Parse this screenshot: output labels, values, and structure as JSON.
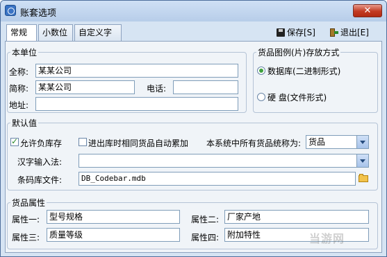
{
  "window": {
    "title": "账套选项",
    "close_label": "✕"
  },
  "tabs": [
    {
      "label": "常规"
    },
    {
      "label": "小数位"
    },
    {
      "label": "自定义字段"
    }
  ],
  "toolbar": {
    "save_label": "保存[S]",
    "exit_label": "退出[E]"
  },
  "unit": {
    "legend": "本单位",
    "fullname_label": "全称:",
    "fullname_value": "某某公司",
    "shortname_label": "简称:",
    "shortname_value": "某某公司",
    "phone_label": "电话:",
    "phone_value": "",
    "address_label": "地址:",
    "address_value": ""
  },
  "storage": {
    "legend": "货品图例(片)存放方式",
    "option_db": "数据库(二进制形式)",
    "option_disk": "硬  盘(文件形式)",
    "selected": "database"
  },
  "defaults": {
    "legend": "默认值",
    "allow_negative_label": "允许负库存",
    "allow_negative_checked": true,
    "merge_label": "进出库时相同货品自动累加",
    "merge_checked": false,
    "goods_name_label": "本系统中所有货品统称为:",
    "goods_name_value": "货品",
    "ime_label": "汉字输入法:",
    "ime_value": "",
    "barcode_label": "条码库文件:",
    "barcode_value": "DB_Codebar.mdb"
  },
  "attrs": {
    "legend": "货品属性",
    "attr1_label": "属性一:",
    "attr1_value": "型号规格",
    "attr2_label": "属性二:",
    "attr2_value": "厂家产地",
    "attr3_label": "属性三:",
    "attr3_value": "质量等级",
    "attr4_label": "属性四:",
    "attr4_value": "附加特性"
  },
  "watermark": "当游网"
}
